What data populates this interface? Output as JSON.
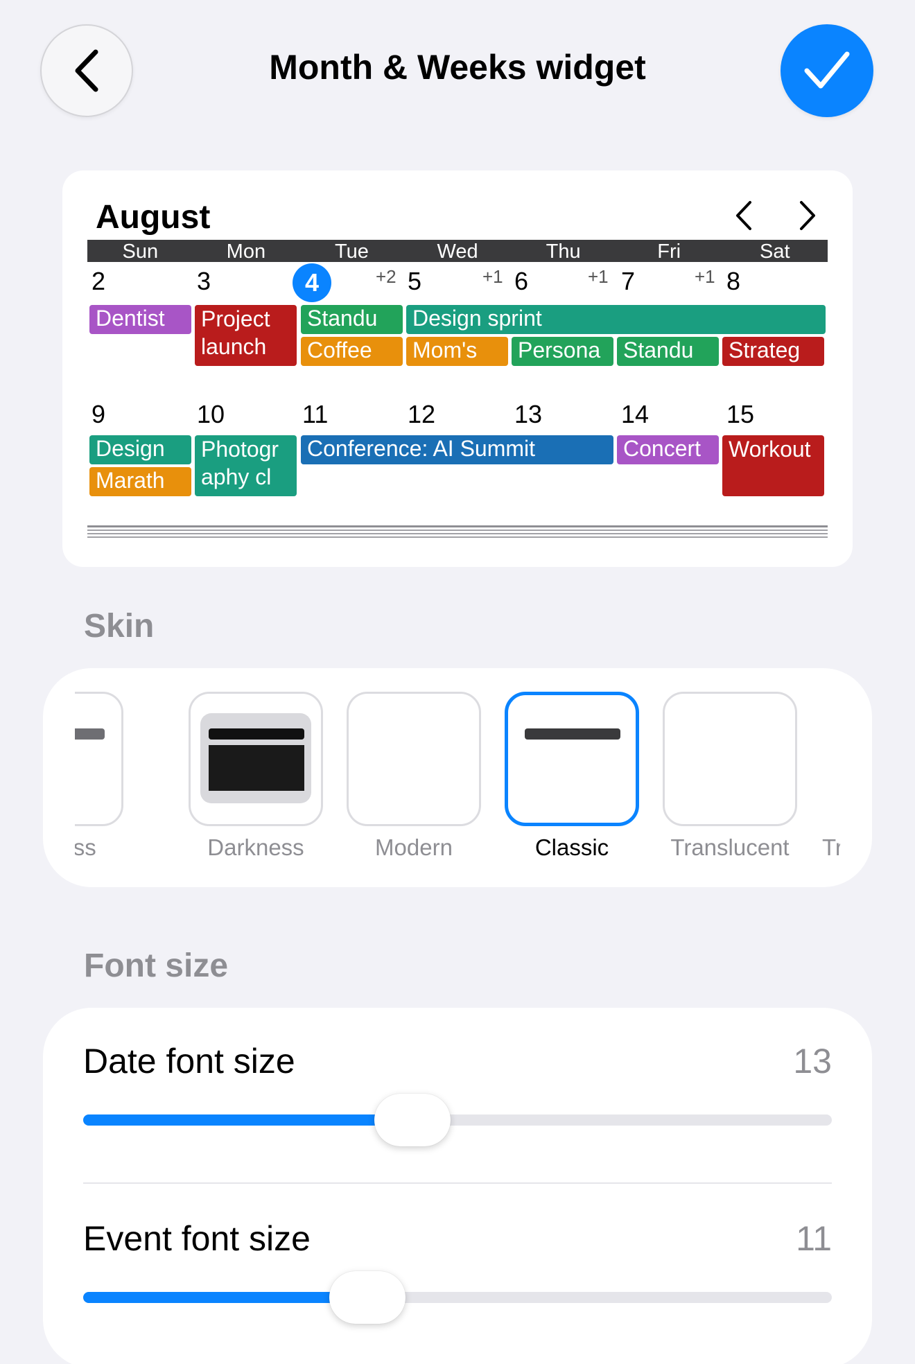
{
  "header": {
    "title": "Month & Weeks widget",
    "back_icon": "chevron-left-icon",
    "confirm_icon": "checkmark-icon",
    "accent_color": "#0a84ff"
  },
  "preview": {
    "month": "August",
    "weekdays": [
      "Sun",
      "Mon",
      "Tue",
      "Wed",
      "Thu",
      "Fri",
      "Sat"
    ],
    "week1": {
      "days": [
        "2",
        "3",
        "4",
        "5",
        "6",
        "7",
        "8"
      ],
      "today": "4",
      "more": [
        "+2",
        "+1",
        "+1",
        "+1"
      ],
      "events": [
        {
          "label": "Dentist",
          "color": "#a855c6"
        },
        {
          "label": "Project launch",
          "color": "#b91c1c"
        },
        {
          "label": "Standu",
          "color": "#22a35a"
        },
        {
          "label": "Design sprint",
          "color": "#1a9e80"
        },
        {
          "label": "Coffee",
          "color": "#e8900c"
        },
        {
          "label": "Mom's",
          "color": "#e8900c"
        },
        {
          "label": "Persona",
          "color": "#22a35a"
        },
        {
          "label": "Standu",
          "color": "#22a35a"
        },
        {
          "label": "Strateg",
          "color": "#b91c1c"
        }
      ]
    },
    "week2": {
      "days": [
        "9",
        "10",
        "11",
        "12",
        "13",
        "14",
        "15"
      ],
      "events": [
        {
          "label": "Design",
          "color": "#1a9e80"
        },
        {
          "label": "Marath",
          "color": "#e8900c"
        },
        {
          "label": "Photography cl",
          "color": "#1a9e80"
        },
        {
          "label": "Conference: AI Summit",
          "color": "#1a6fb5"
        },
        {
          "label": "Concert",
          "color": "#a855c6"
        },
        {
          "label": "Workout",
          "color": "#b91c1c"
        }
      ]
    }
  },
  "skin": {
    "section_label": "Skin",
    "options": [
      {
        "label": "ghtness"
      },
      {
        "label": "Darkness"
      },
      {
        "label": "Modern"
      },
      {
        "label": "Classic",
        "selected": true
      },
      {
        "label": "Translucent"
      },
      {
        "label": "Tr"
      }
    ]
  },
  "font_size": {
    "section_label": "Font size",
    "date": {
      "label": "Date font size",
      "value": "13",
      "fraction": 0.44
    },
    "event": {
      "label": "Event font size",
      "value": "11",
      "fraction": 0.38
    }
  }
}
